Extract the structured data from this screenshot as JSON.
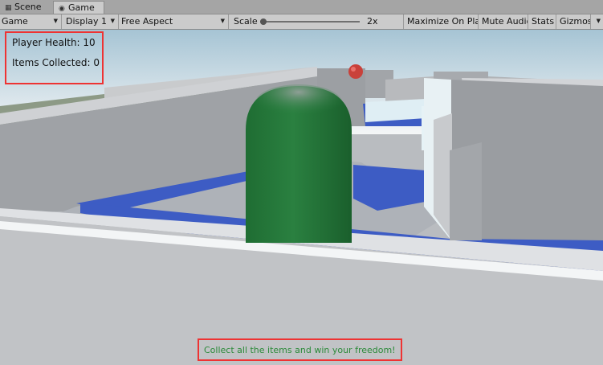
{
  "tabs": [
    {
      "label": "Scene",
      "icon": "scene-icon"
    },
    {
      "label": "Game",
      "icon": "gamepad-icon",
      "active": true
    }
  ],
  "toolbar": {
    "game_dropdown": "Game",
    "display_dropdown": "Display 1",
    "aspect_dropdown": "Free Aspect",
    "scale_label": "Scale",
    "scale_value": "2x",
    "maximize_on_play": "Maximize On Play",
    "mute_audio": "Mute Audio",
    "stats": "Stats",
    "gizmos": "Gizmos"
  },
  "hud": {
    "player_health": "Player Health: 10",
    "items_collected": "Items Collected: 0"
  },
  "message": "Collect all the items and win your freedom!",
  "colors": {
    "floor_blue": "#3d5cc4",
    "player_green": "#23733a",
    "highlight_red": "#e33333",
    "message_green": "#2b8a39"
  }
}
